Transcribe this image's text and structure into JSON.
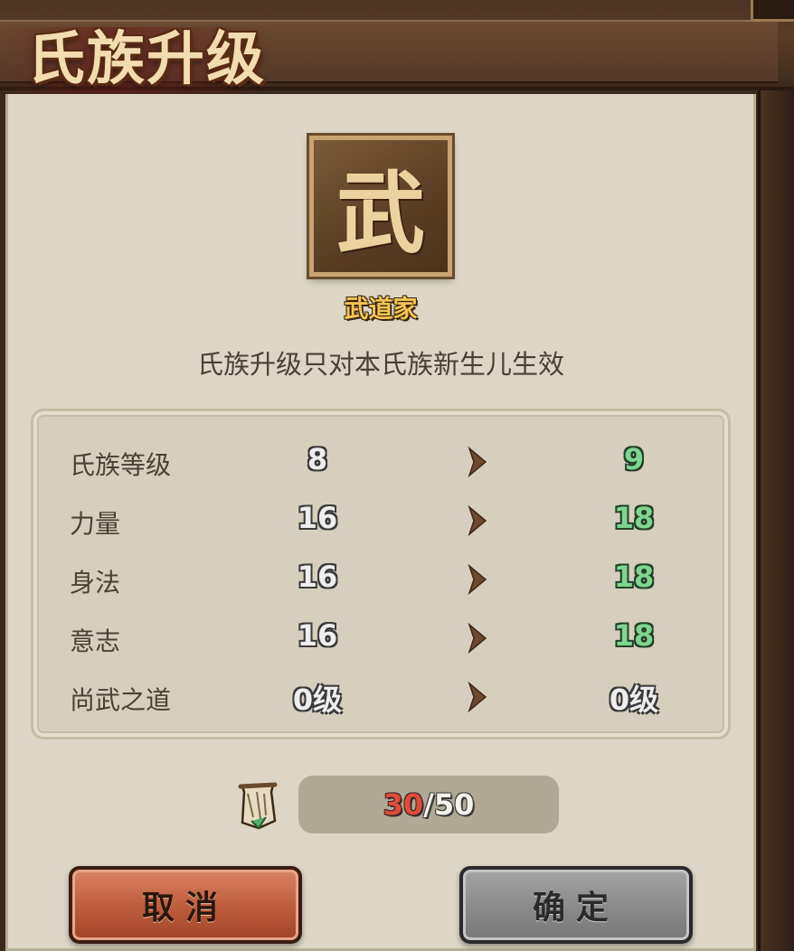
{
  "header": {
    "title": "氏族升级"
  },
  "clan": {
    "emblem_char": "武",
    "name": "武道家"
  },
  "notice": "氏族升级只对本氏族新生儿生效",
  "stats": [
    {
      "label": "氏族等级",
      "from": "8",
      "to": "9",
      "change": "up"
    },
    {
      "label": "力量",
      "from": "16",
      "to": "18",
      "change": "up"
    },
    {
      "label": "身法",
      "from": "16",
      "to": "18",
      "change": "up"
    },
    {
      "label": "意志",
      "from": "16",
      "to": "18",
      "change": "up"
    },
    {
      "label": "尚武之道",
      "from": "0级",
      "to": "0级",
      "change": "same"
    }
  ],
  "cost": {
    "item_icon": "scroll-item-icon",
    "current": "30",
    "separator": "/",
    "required": "50"
  },
  "buttons": {
    "cancel": "取消",
    "confirm": "确定"
  },
  "colors": {
    "increase": "#7fd590",
    "insufficient": "#e24a3a",
    "cancel_button": "#bd5b3c",
    "confirm_button_disabled": "#8a8a8a"
  }
}
